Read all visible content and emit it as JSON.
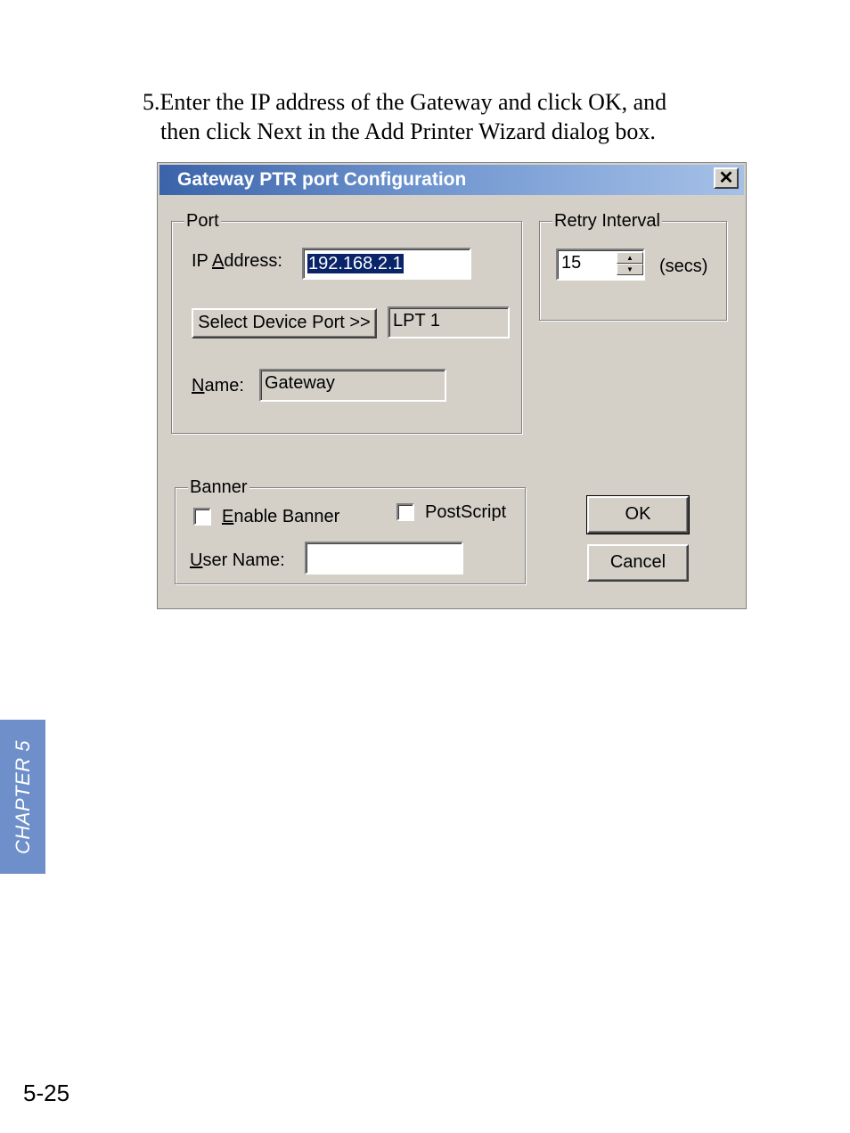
{
  "instruction": {
    "line1": "5.Enter the IP address of the Gateway and click OK, and",
    "line2": "then click Next in the Add Printer Wizard dialog box."
  },
  "dialog": {
    "title": "Gateway PTR port Configuration",
    "close_glyph": "✕",
    "port": {
      "legend": "Port",
      "ip_label_pre": "IP ",
      "ip_label_accel": "A",
      "ip_label_post": "ddress:",
      "ip_value": "192.168.2.1",
      "select_button": "Select Device Port >>",
      "device_port_value": "LPT 1",
      "name_label_accel": "N",
      "name_label_post": "ame:",
      "name_value": "Gateway"
    },
    "retry": {
      "legend": "Retry Interval",
      "value": "15",
      "unit": "(secs)",
      "spin_up": "▲",
      "spin_down": "▼"
    },
    "banner": {
      "legend": "Banner",
      "enable_accel": "E",
      "enable_post": "nable Banner",
      "enable_checked": false,
      "postscript_label": "PostScript",
      "postscript_checked": false,
      "username_accel": "U",
      "username_post": "ser Name:",
      "username_value": ""
    },
    "ok_label": "OK",
    "cancel_label": "Cancel"
  },
  "sidebar_tab": "CHAPTER 5",
  "page_number": "5-25"
}
